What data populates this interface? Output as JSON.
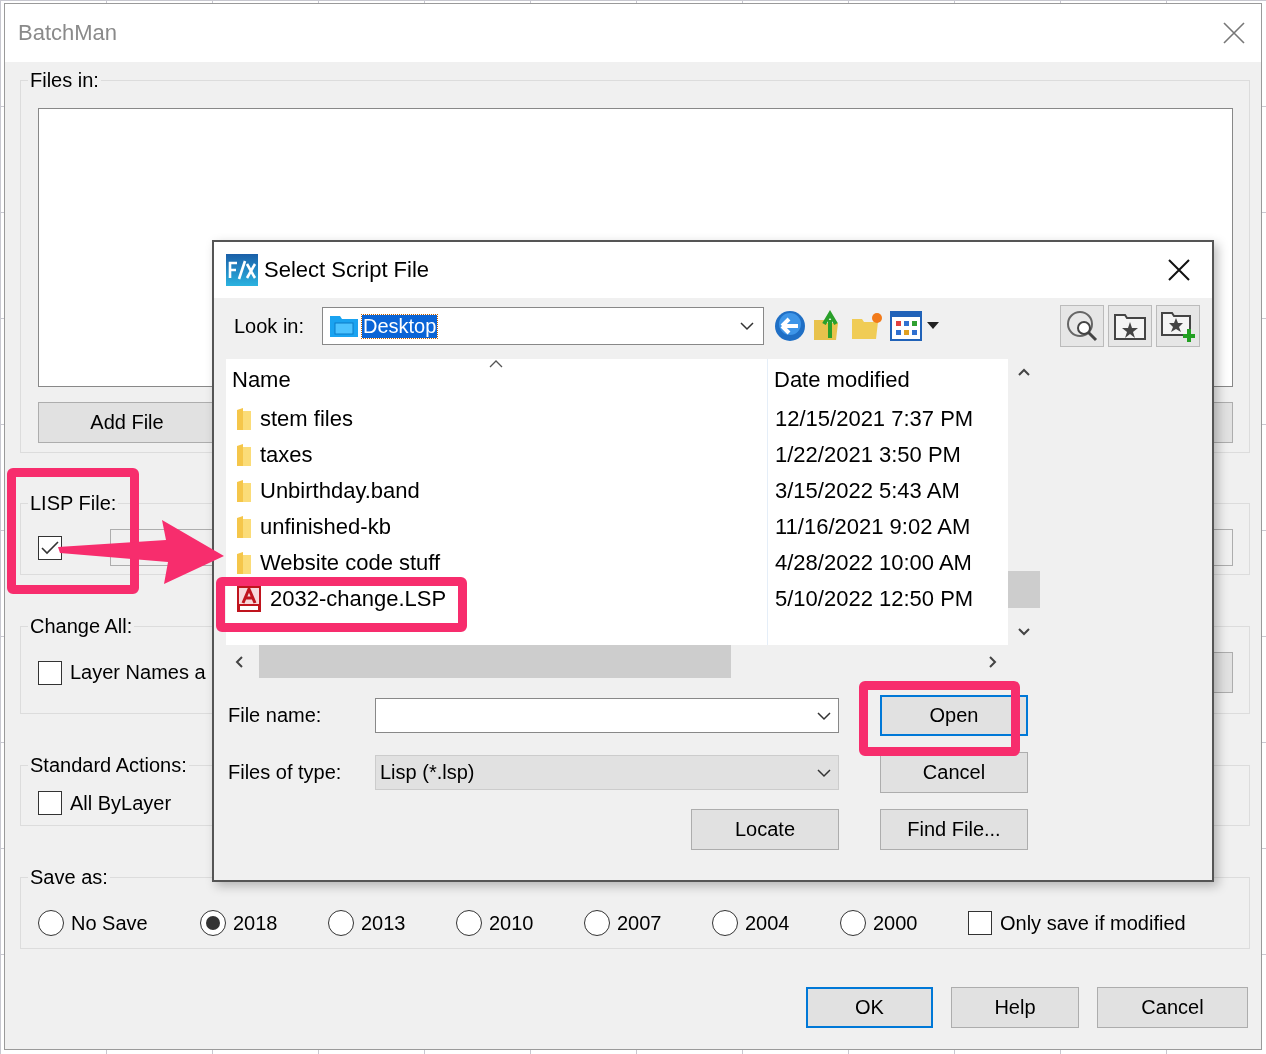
{
  "window": {
    "title": "BatchMan"
  },
  "files_in": {
    "label": "Files in:",
    "buttons": [
      "Add File"
    ]
  },
  "lisp_file": {
    "label": "LISP File:",
    "checked": true
  },
  "change_all": {
    "label": "Change All:",
    "options": [
      {
        "label": "Layer Names a",
        "checked": false
      }
    ]
  },
  "standard_actions": {
    "label": "Standard Actions:",
    "options": [
      {
        "label": "All ByLayer",
        "checked": false
      }
    ]
  },
  "save_as": {
    "label": "Save as:",
    "options": [
      {
        "label": "No Save",
        "selected": false
      },
      {
        "label": "2018",
        "selected": true
      },
      {
        "label": "2013",
        "selected": false
      },
      {
        "label": "2010",
        "selected": false
      },
      {
        "label": "2007",
        "selected": false
      },
      {
        "label": "2004",
        "selected": false
      },
      {
        "label": "2000",
        "selected": false
      }
    ],
    "only_modified": {
      "label": "Only save if modified",
      "checked": false
    }
  },
  "buttons": [
    {
      "label": "OK",
      "focused": true
    },
    {
      "label": "Help",
      "focused": false
    },
    {
      "label": "Cancel",
      "focused": false
    }
  ],
  "dialog": {
    "title": "Select Script File",
    "look_in": {
      "label": "Look in:",
      "value": "Desktop"
    },
    "columns": [
      "Name",
      "Date modified"
    ],
    "files": [
      {
        "kind": "folder",
        "name": "stem files",
        "date": "12/15/2021 7:37 PM"
      },
      {
        "kind": "folder",
        "name": "taxes",
        "date": "1/22/2021 3:50 PM"
      },
      {
        "kind": "folder",
        "name": "Unbirthday.band",
        "date": "3/15/2022 5:43 AM"
      },
      {
        "kind": "folder",
        "name": "unfinished-kb",
        "date": "11/16/2021 9:02 AM"
      },
      {
        "kind": "folder",
        "name": "Website code stuff",
        "date": "4/28/2022 10:00 AM"
      },
      {
        "kind": "lisp",
        "name": "2032-change.LSP",
        "date": "5/10/2022 12:50 PM"
      }
    ],
    "file_name": {
      "label": "File name:"
    },
    "files_of_type": {
      "label": "Files of type:",
      "value": "Lisp (*.lsp)"
    },
    "buttons": [
      {
        "label": "Open",
        "focused": true
      },
      {
        "label": "Cancel",
        "focused": false
      },
      {
        "label": "Locate",
        "focused": false
      },
      {
        "label": "Find File...",
        "focused": false
      }
    ]
  }
}
